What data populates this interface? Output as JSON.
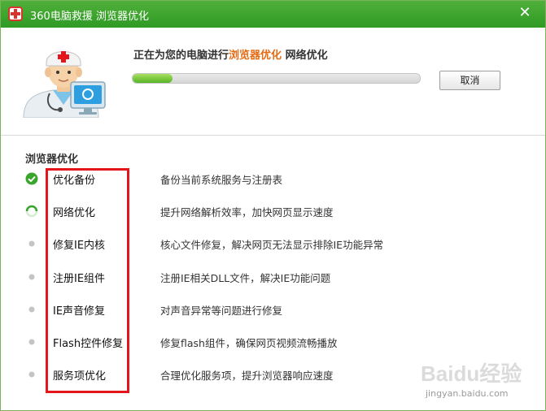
{
  "window": {
    "app_name": "360电脑救援",
    "title_suffix": "浏览器优化",
    "close_glyph": "✕"
  },
  "status": {
    "prefix": "正在为您的电脑进行",
    "highlight": "浏览器优化",
    "suffix": "网络优化",
    "progress_fraction": 0.14,
    "cancel_label": "取消"
  },
  "section": {
    "title": "浏览器优化"
  },
  "items": [
    {
      "name": "优化备份",
      "desc": "备份当前系统服务与注册表",
      "state": "done",
      "icon": "check-circle-icon"
    },
    {
      "name": "网络优化",
      "desc": "提升网络解析效率，加快网页显示速度",
      "state": "running",
      "icon": "spinner-icon"
    },
    {
      "name": "修复IE内核",
      "desc": "核心文件修复，解决网页无法显示排除IE功能异常",
      "state": "pending",
      "icon": "dot-icon"
    },
    {
      "name": "注册IE组件",
      "desc": "注册IE相关DLL文件，解决IE功能问题",
      "state": "pending",
      "icon": "dot-icon"
    },
    {
      "name": "IE声音修复",
      "desc": "对声音异常等问题进行修复",
      "state": "pending",
      "icon": "dot-icon"
    },
    {
      "name": "Flash控件修复",
      "desc": "修复flash组件，确保网页视频流畅播放",
      "state": "pending",
      "icon": "dot-icon"
    },
    {
      "name": "服务项优化",
      "desc": "合理优化服务项，提升浏览器响应速度",
      "state": "pending",
      "icon": "dot-icon"
    }
  ],
  "colors": {
    "title_bar": "#3aa52c",
    "highlight_text": "#e56a12",
    "progress_green": "#6cc236",
    "done_green": "#3aa52c",
    "annotation_red": "#e5151c"
  },
  "watermark": {
    "brand": "Baidu经验",
    "url": "jingyan.baidu.com"
  }
}
